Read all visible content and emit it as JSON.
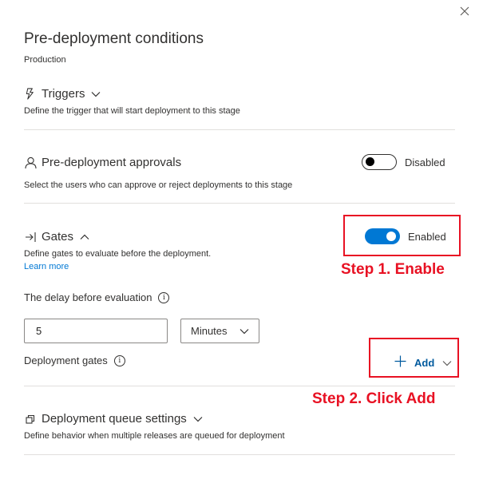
{
  "panel": {
    "title": "Pre-deployment conditions",
    "subtitle": "Production"
  },
  "triggers": {
    "title": "Triggers",
    "description": "Define the trigger that will start deployment to this stage"
  },
  "approvals": {
    "title": "Pre-deployment approvals",
    "description": "Select the users who can approve or reject deployments to this stage",
    "toggle_label": "Disabled",
    "enabled": false
  },
  "gates": {
    "title": "Gates",
    "description": "Define gates to evaluate before the deployment.",
    "learn_more": "Learn more",
    "toggle_label": "Enabled",
    "enabled": true,
    "delay_label": "The delay before evaluation",
    "delay_value": "5",
    "delay_unit": "Minutes",
    "deployment_gates_label": "Deployment gates",
    "add_label": "Add"
  },
  "queue": {
    "title": "Deployment queue settings",
    "description": "Define behavior when multiple releases are queued for deployment"
  },
  "annotations": {
    "step1": "Step 1. Enable",
    "step2": "Step 2. Click Add",
    "color": "#e81123"
  },
  "colors": {
    "accent": "#0078d4",
    "link": "#0078d4"
  },
  "icons": {
    "close": "close-icon",
    "triggers": "lightning-icon",
    "approvals": "person-icon",
    "gates": "gate-icon",
    "queue": "queue-icon",
    "info": "info-icon",
    "add": "plus-icon"
  }
}
